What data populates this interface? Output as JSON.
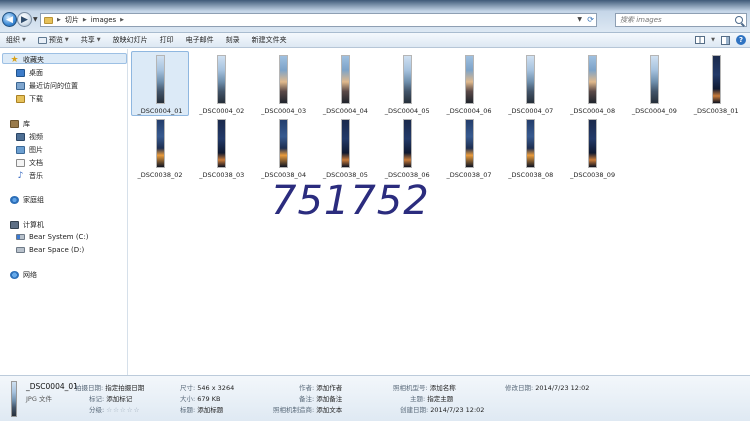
{
  "address": {
    "crumbs": [
      "切片",
      "images"
    ]
  },
  "search": {
    "placeholder": "搜索 images"
  },
  "toolbar": {
    "items": [
      "组织",
      "预览",
      "共享",
      "放映幻灯片",
      "打印",
      "电子邮件",
      "刻录",
      "新建文件夹"
    ]
  },
  "nav": {
    "favorites": "收藏夹",
    "desktop": "桌面",
    "recent": "最近访问的位置",
    "downloads": "下载",
    "libraries": "库",
    "videos": "视频",
    "pictures": "图片",
    "documents": "文档",
    "music": "音乐",
    "homegroup": "家庭组",
    "computer": "计算机",
    "drive_c": "Bear System (C:)",
    "drive_d": "Bear Space (D:)",
    "network": "网络"
  },
  "files": [
    "_DSC0004_01",
    "_DSC0004_02",
    "_DSC0004_03",
    "_DSC0004_04",
    "_DSC0004_05",
    "_DSC0004_06",
    "_DSC0004_07",
    "_DSC0004_08",
    "_DSC0004_09",
    "_DSC0038_01",
    "_DSC0038_02",
    "_DSC0038_03",
    "_DSC0038_04",
    "_DSC0038_05",
    "_DSC0038_06",
    "_DSC0038_07",
    "_DSC0038_08",
    "_DSC0038_09"
  ],
  "selected_file": "_DSC0004_01",
  "watermark": "751752",
  "details": {
    "name": "_DSC0004_01",
    "type": "JPG 文件",
    "shot_date_k": "拍摄日期:",
    "shot_date_v": "指定拍摄日期",
    "tags_k": "标记:",
    "tags_v": "添加标记",
    "rating_k": "分级:",
    "rating_v": "☆☆☆☆☆",
    "dims_k": "尺寸:",
    "dims_v": "546 x 3264",
    "size_k": "大小:",
    "size_v": "679 KB",
    "title_k": "标题:",
    "title_v": "添加标题",
    "author_k": "作者:",
    "author_v": "添加作者",
    "comment_k": "备注:",
    "comment_v": "添加备注",
    "maker_k": "照相机制造商:",
    "maker_v": "添加文本",
    "model_k": "照相机型号:",
    "model_v": "添加名称",
    "subject_k": "主题:",
    "subject_v": "指定主题",
    "created_k": "创建日期:",
    "created_v": "2014/7/23 12:02",
    "modified_k": "修改日期:",
    "modified_v": "2014/7/23 12:02"
  }
}
